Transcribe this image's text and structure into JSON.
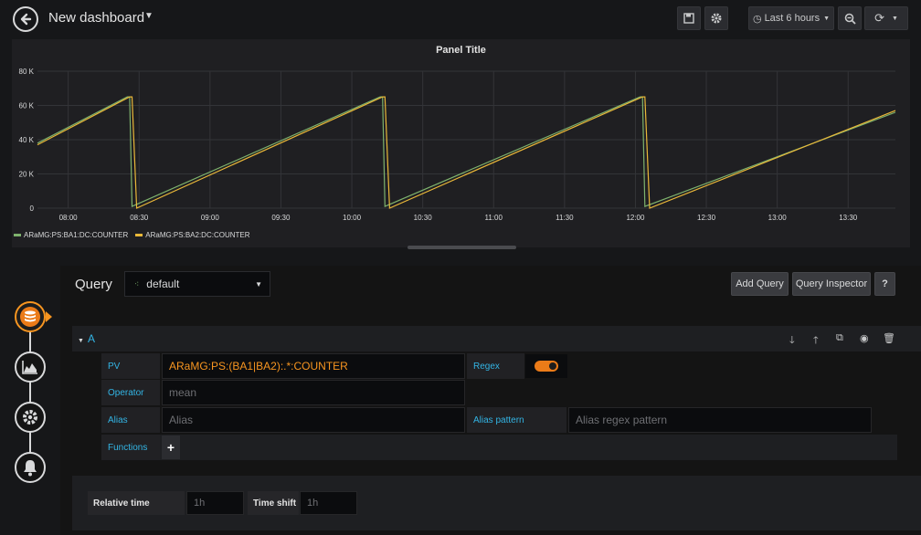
{
  "header": {
    "title": "New dashboard",
    "time_range": "Last 6 hours"
  },
  "panel": {
    "title": "Panel Title",
    "legend": [
      {
        "label": "ARaMG:PS:BA1:DC:COUNTER",
        "color": "#7eb26d"
      },
      {
        "label": "ARaMG:PS:BA2:DC:COUNTER",
        "color": "#eab839"
      }
    ]
  },
  "chart_data": {
    "type": "line",
    "title": "Panel Title",
    "y_ticks": [
      "0",
      "20 K",
      "40 K",
      "60 K",
      "80 K"
    ],
    "x_ticks": [
      "08:00",
      "08:30",
      "09:00",
      "09:30",
      "10:00",
      "10:30",
      "11:00",
      "11:30",
      "12:00",
      "12:30",
      "13:00",
      "13:30"
    ],
    "ylim": [
      0,
      80000
    ],
    "xlim": [
      "07:47",
      "13:50"
    ],
    "grid": true,
    "legend_placement": "bottom-left",
    "series": [
      {
        "name": "ARaMG:PS:BA1:DC:COUNTER",
        "color": "#7eb26d",
        "x": [
          "07:47",
          "08:25",
          "08:26",
          "08:27",
          "10:12",
          "10:13",
          "10:14",
          "12:02",
          "12:03",
          "12:04",
          "13:50"
        ],
        "y": [
          38000,
          65000,
          65000,
          1000,
          65000,
          65000,
          1000,
          65000,
          65000,
          1000,
          56000
        ]
      },
      {
        "name": "ARaMG:PS:BA2:DC:COUNTER",
        "color": "#eab839",
        "x": [
          "07:47",
          "08:26",
          "08:27",
          "08:29",
          "10:13",
          "10:14",
          "10:16",
          "12:03",
          "12:04",
          "12:06",
          "13:50"
        ],
        "y": [
          37000,
          65000,
          65000,
          0,
          65000,
          65000,
          0,
          65000,
          65000,
          0,
          57000
        ]
      }
    ]
  },
  "editor": {
    "query_label": "Query",
    "datasource": "default",
    "add_query": "Add Query",
    "query_inspector": "Query Inspector",
    "help": "?",
    "query": {
      "letter": "A",
      "pv_label": "PV",
      "pv_value": "ARaMG:PS:(BA1|BA2):.*:COUNTER",
      "regex_label": "Regex",
      "regex_enabled": true,
      "operator_label": "Operator",
      "operator_placeholder": "mean",
      "alias_label": "Alias",
      "alias_placeholder": "Alias",
      "alias_pattern_label": "Alias pattern",
      "alias_pattern_placeholder": "Alias regex pattern",
      "functions_label": "Functions",
      "add_function": "+"
    },
    "options": {
      "relative_time_label": "Relative time",
      "relative_time_placeholder": "1h",
      "time_shift_label": "Time shift",
      "time_shift_placeholder": "1h"
    }
  }
}
